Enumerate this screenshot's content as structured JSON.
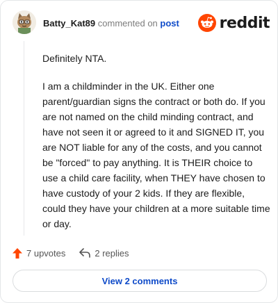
{
  "header": {
    "username": "Batty_Kat89",
    "commented_text": "commented on",
    "post_link": "post",
    "brand": "reddit"
  },
  "comment": {
    "paragraphs": [
      "Definitely NTA.",
      "I am a childminder in the UK. Either one parent/guardian signs the contract or both do. If you are not named on the child minding contract, and have not seen it or agreed to it and SIGNED IT, you are NOT liable for any of the costs, and you cannot be \"forced\" to pay anything. It is THEIR choice to use a child care facility, when THEY have chosen to have custody of your 2 kids. If they are flexible, could they have your children at a more suitable time or day."
    ]
  },
  "actions": {
    "upvotes": "7 upvotes",
    "replies": "2 replies"
  },
  "view_comments": "View 2 comments",
  "colors": {
    "reddit_orange": "#ff4500",
    "link_blue": "#0f4bc9",
    "upvote_orange": "#ff4500"
  },
  "icons": {
    "avatar": "cat-avatar",
    "logo": "reddit-snoo-icon",
    "upvote": "upvote-arrow-icon",
    "reply": "reply-arrow-icon"
  }
}
